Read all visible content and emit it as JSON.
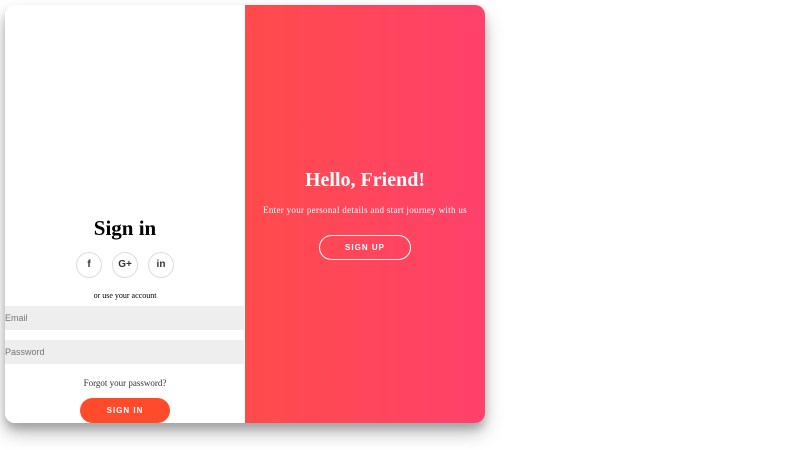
{
  "signin": {
    "title": "Sign in",
    "social": [
      {
        "label": "f",
        "icon": "facebook-icon"
      },
      {
        "label": "G+",
        "icon": "google-plus-icon"
      },
      {
        "label": "in",
        "icon": "linkedin-icon"
      }
    ],
    "alt_text": "or use your account",
    "email_placeholder": "Email",
    "password_placeholder": "Password",
    "forgot": "Forgot your password?",
    "button": "SIGN IN"
  },
  "overlay": {
    "title": "Hello, Friend!",
    "text": "Enter your personal details and start journey with us",
    "button": "SIGN UP"
  },
  "colors": {
    "gradient_start": "#ff4b4b",
    "gradient_end": "#ff416c",
    "primary_button": "#ff4b2b",
    "field_background": "#eeeeee"
  }
}
